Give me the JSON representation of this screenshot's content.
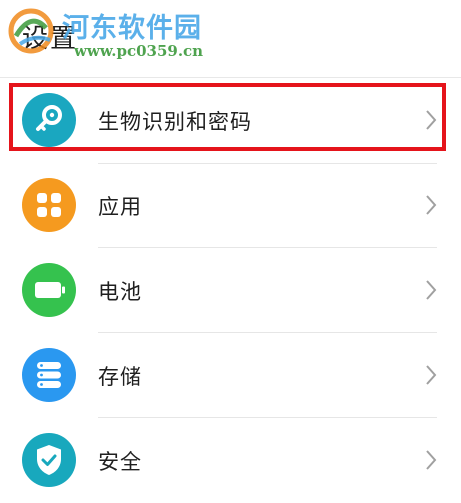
{
  "header": {
    "title": "设置"
  },
  "watermark": {
    "title": "河东软件园",
    "url": "www.pc0359.cn"
  },
  "settings_items": [
    {
      "label": "生物识别和密码",
      "icon": "key-icon",
      "color": "#1aa7c0",
      "highlighted": true
    },
    {
      "label": "应用",
      "icon": "apps-grid-icon",
      "color": "#f59a1f"
    },
    {
      "label": "电池",
      "icon": "battery-icon",
      "color": "#35c24e"
    },
    {
      "label": "存储",
      "icon": "storage-icon",
      "color": "#2a98f0"
    },
    {
      "label": "安全",
      "icon": "shield-check-icon",
      "color": "#18a8bd"
    }
  ],
  "colors": {
    "highlight_border": "#e5141b",
    "chevron": "#a0a0a0"
  }
}
